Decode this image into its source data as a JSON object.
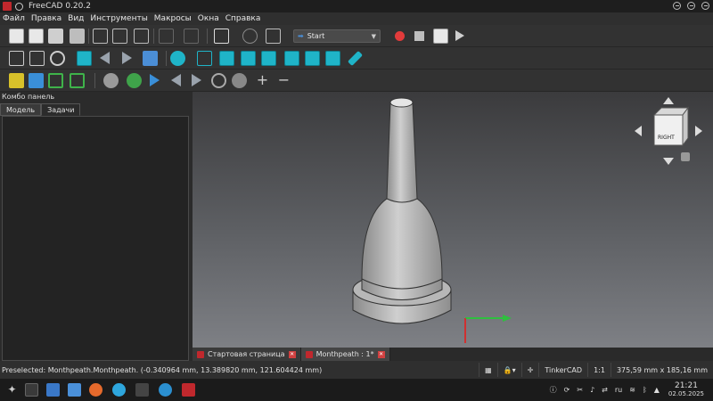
{
  "window": {
    "title": "FreeCAD 0.20.2"
  },
  "menu": {
    "items": [
      "Файл",
      "Правка",
      "Вид",
      "Инструменты",
      "Макросы",
      "Окна",
      "Справка"
    ]
  },
  "toolbar": {
    "workbench": "Start"
  },
  "combo": {
    "title": "Комбо панель",
    "tabs": [
      "Модель",
      "Задачи"
    ],
    "active_tab": "Задачи"
  },
  "viewport": {
    "navcube_face": "RIGHT"
  },
  "doc_tabs": [
    {
      "label": "Стартовая страница",
      "active": false
    },
    {
      "label": "Monthpeath : 1*",
      "active": true
    }
  ],
  "status": {
    "message": "Preselected: Monthpeath.Monthpeath. (-0.340964 mm, 13.389820 mm, 121.604424 mm)",
    "nav_style": "TinkerCAD",
    "scale": "1:1",
    "dimensions": "375,59 mm x 185,16 mm"
  },
  "taskbar": {
    "lang": "ru",
    "time": "21:21",
    "date": "02.05.2025"
  },
  "colors": {
    "accent": "#1fb4c8",
    "record": "#e23b3b",
    "axis_green": "#2fbf3f"
  }
}
